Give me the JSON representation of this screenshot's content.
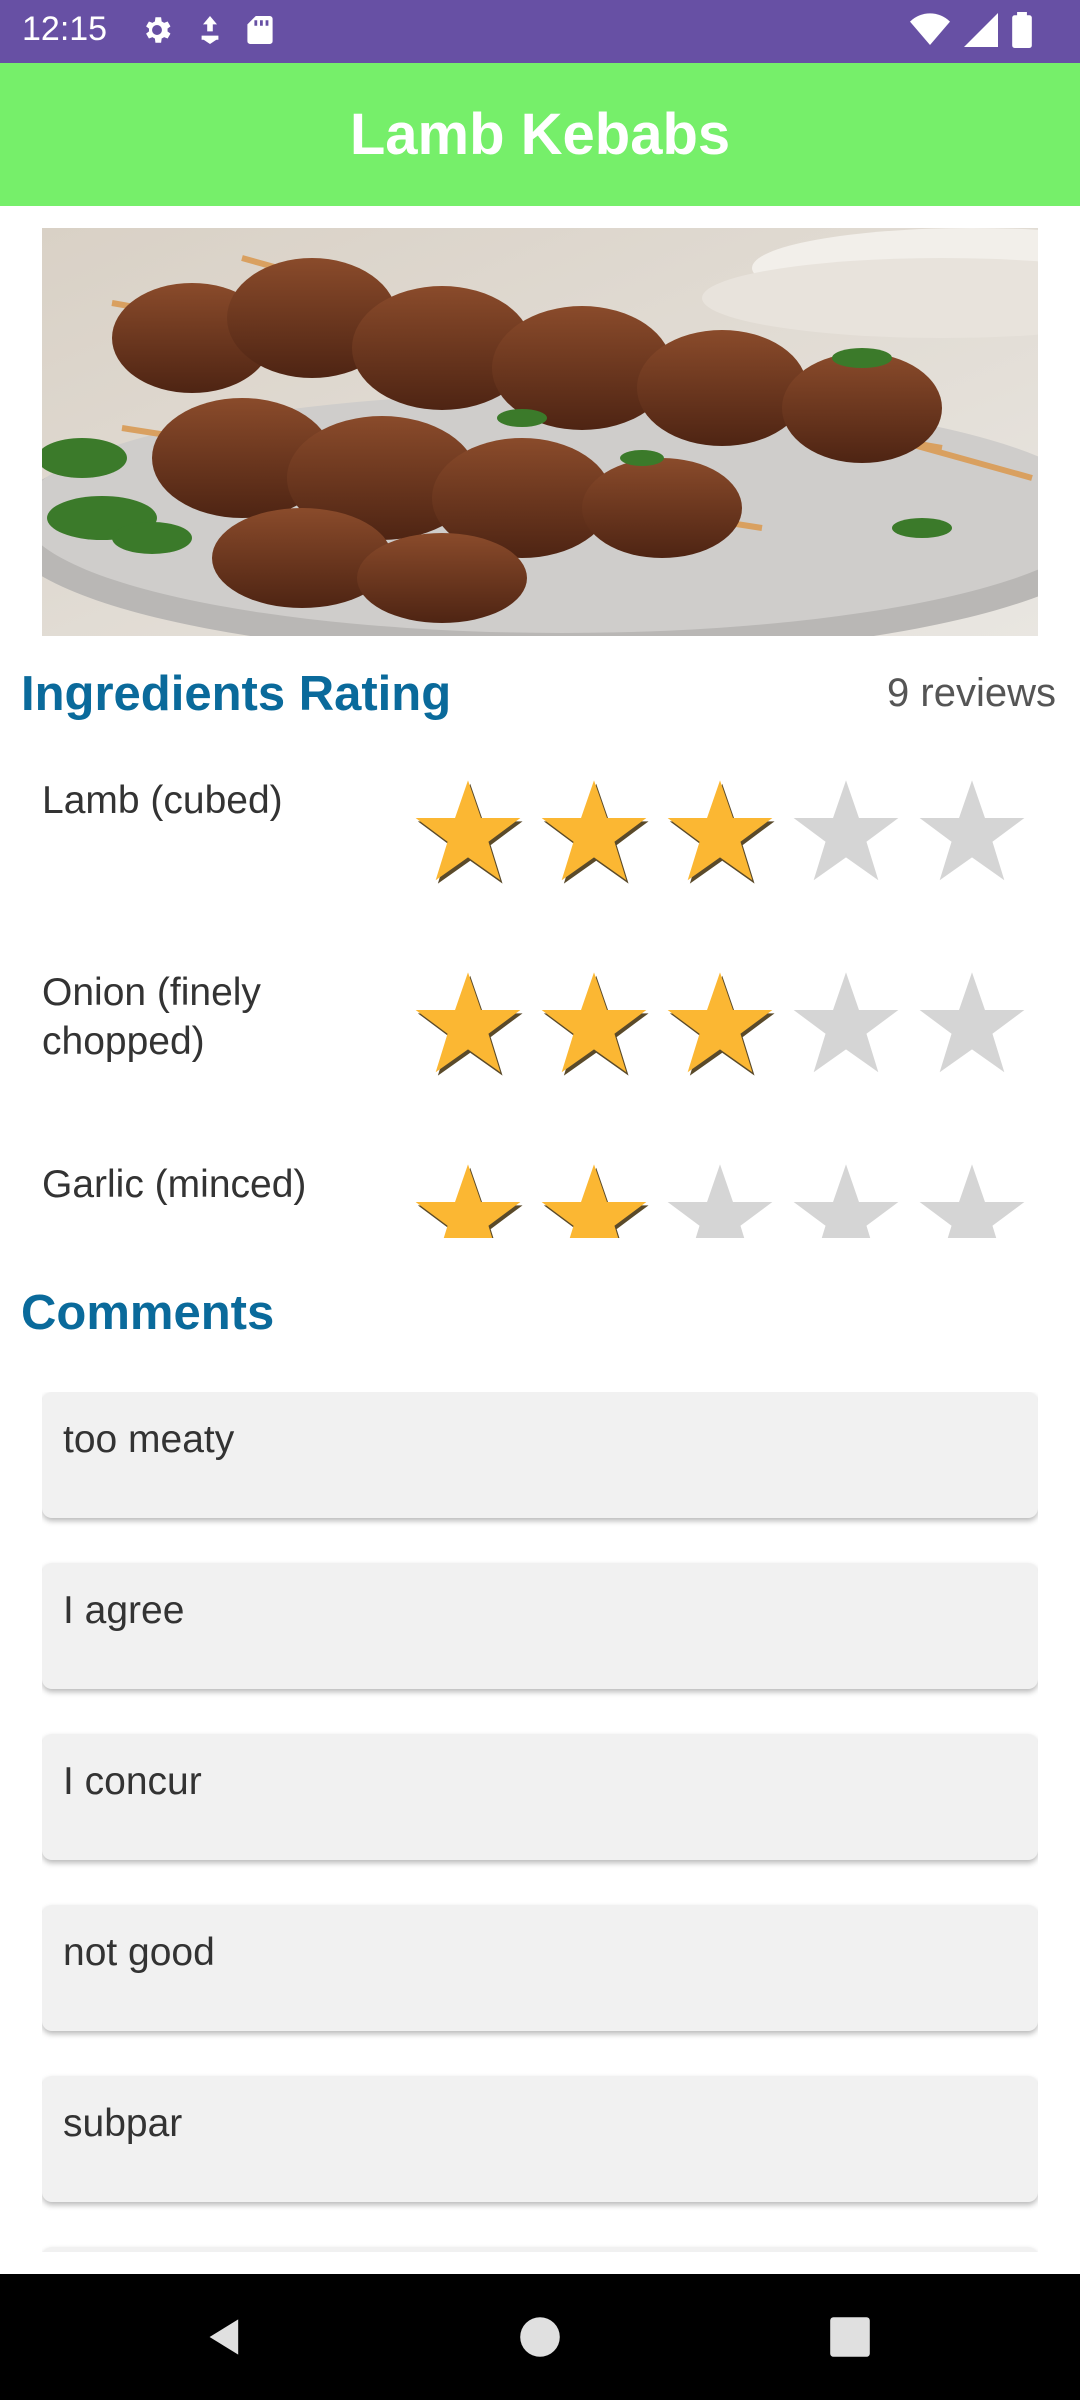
{
  "status_bar": {
    "time": "12:15",
    "left_icons": [
      "settings-icon",
      "download-icon",
      "sd-card-icon"
    ],
    "right_icons": [
      "wifi-icon",
      "signal-icon",
      "battery-icon"
    ],
    "background": "#6750a4"
  },
  "app_bar": {
    "title": "Lamb Kebabs",
    "background": "#76ef6a"
  },
  "hero_image": {
    "subject": "lamb kebab skewers on a plate"
  },
  "ratings": {
    "title": "Ingredients Rating",
    "reviews": "9 reviews",
    "max_stars": 5,
    "colors": {
      "filled": "#fbb733",
      "empty": "#d5d5d5"
    },
    "items": [
      {
        "name": "Lamb (cubed)",
        "stars": 3
      },
      {
        "name": "Onion (finely chopped)",
        "stars": 3
      },
      {
        "name": "Garlic (minced)",
        "stars": 2
      }
    ]
  },
  "comments": {
    "title": "Comments",
    "items": [
      "too meaty",
      "I agree",
      "I concur",
      "not good",
      "subpar",
      ""
    ]
  },
  "nav_bar": {
    "buttons": [
      "back-icon",
      "home-icon",
      "recents-icon"
    ]
  }
}
